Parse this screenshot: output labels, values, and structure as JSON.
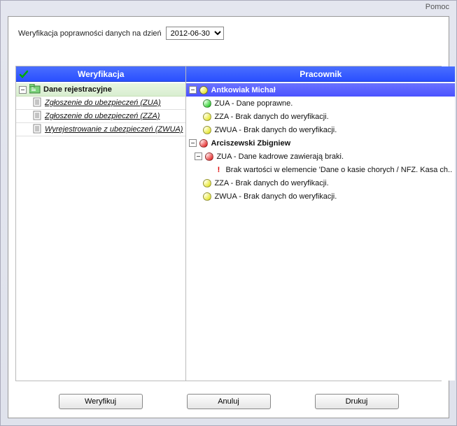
{
  "title_menu": "Pomoc",
  "top": {
    "label": "Weryfikacja poprawności danych na dzień",
    "date": "2012-06-30"
  },
  "left_panel": {
    "header": "Weryfikacja",
    "root": {
      "label": "Dane rejestracyjne"
    },
    "items": [
      {
        "label": "Zgłoszenie do ubezpieczeń (ZUA)"
      },
      {
        "label": "Zgłoszenie do ubezpieczeń (ZZA)"
      },
      {
        "label": "Wyrejestrowanie z ubezpieczeń (ZWUA)"
      }
    ]
  },
  "right_panel": {
    "header": "Pracownik",
    "tree": [
      {
        "name": "Antkowiak Michał",
        "status": "yellow",
        "selected": true,
        "children": [
          {
            "status": "green",
            "text": "ZUA - Dane poprawne."
          },
          {
            "status": "yellow",
            "text": "ZZA - Brak danych do weryfikacji."
          },
          {
            "status": "yellow",
            "text": "ZWUA - Brak danych do weryfikacji."
          }
        ]
      },
      {
        "name": "Arciszewski Zbigniew",
        "status": "red",
        "children": [
          {
            "status": "red",
            "text": "ZUA - Dane kadrowe zawierają braki.",
            "expandable": true,
            "children": [
              {
                "bang": true,
                "text": "Brak wartości w elemencie 'Dane o kasie chorych / NFZ. Kasa ch.."
              }
            ]
          },
          {
            "status": "yellow",
            "text": "ZZA - Brak danych do weryfikacji."
          },
          {
            "status": "yellow",
            "text": "ZWUA - Brak danych do weryfikacji."
          }
        ]
      }
    ]
  },
  "buttons": {
    "verify": "Weryfikuj",
    "cancel": "Anuluj",
    "print": "Drukuj"
  }
}
